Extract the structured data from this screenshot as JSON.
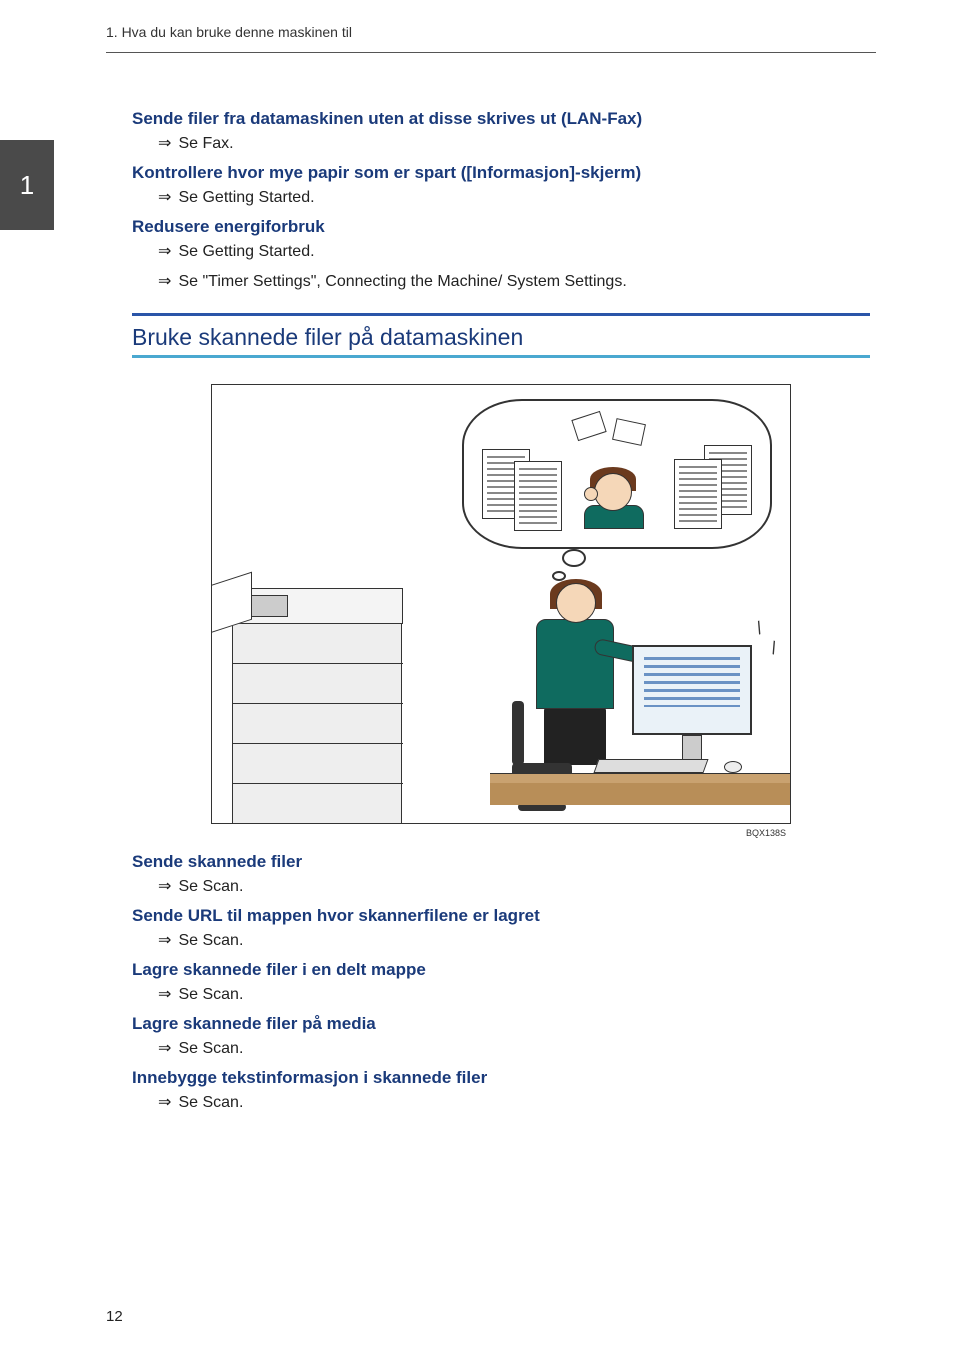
{
  "header": {
    "running_head": "1. Hva du kan bruke denne maskinen til"
  },
  "chapter_tab": "1",
  "arrow_glyph": "⇒",
  "top_block": {
    "items": [
      {
        "bold": "Sende filer fra datamaskinen uten at disse skrives ut (LAN-Fax)",
        "refs": [
          "Se Fax."
        ]
      },
      {
        "bold": "Kontrollere hvor mye papir som er spart ([Informasjon]-skjerm)",
        "refs": [
          "Se Getting Started."
        ]
      },
      {
        "bold": "Redusere energiforbruk",
        "refs": [
          "Se Getting Started.",
          "Se \"Timer Settings\", Connecting the Machine/ System Settings."
        ]
      }
    ]
  },
  "section": {
    "title": "Bruke skannede filer på datamaskinen"
  },
  "figure": {
    "code": "BQX138S"
  },
  "bottom_block": {
    "items": [
      {
        "bold": "Sende skannede filer",
        "refs": [
          "Se Scan."
        ]
      },
      {
        "bold": "Sende URL til mappen hvor skannerfilene er lagret",
        "refs": [
          "Se Scan."
        ]
      },
      {
        "bold": "Lagre skannede filer i en delt mappe",
        "refs": [
          "Se Scan."
        ]
      },
      {
        "bold": "Lagre skannede filer på media",
        "refs": [
          "Se Scan."
        ]
      },
      {
        "bold": "Innebygge tekstinformasjon i skannede filer",
        "refs": [
          "Se Scan."
        ]
      }
    ]
  },
  "page_number": "12"
}
